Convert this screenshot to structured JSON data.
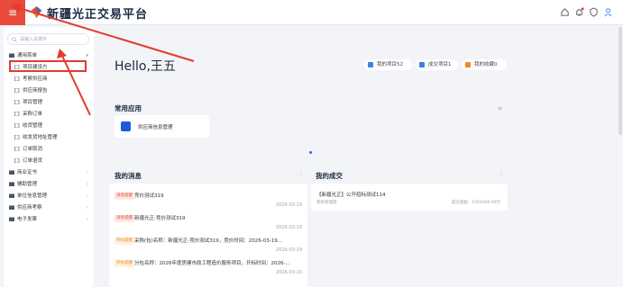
{
  "header": {
    "brand": "新疆光正交易平台",
    "menu_icon": "menu-icon",
    "icons": [
      "home-icon",
      "bell-icon",
      "shield-icon",
      "user-icon"
    ],
    "accent": "#e84b3c"
  },
  "sidebar": {
    "search_placeholder": "请输入关键字",
    "items": [
      {
        "label": "通用菜单",
        "level": 0,
        "expanded": true
      },
      {
        "label": "项目建设方",
        "level": 1,
        "highlighted": true
      },
      {
        "label": "考察供应商",
        "level": 1
      },
      {
        "label": "供应商报告",
        "level": 1
      },
      {
        "label": "项目管理",
        "level": 1
      },
      {
        "label": "采购订单",
        "level": 1
      },
      {
        "label": "收货管理",
        "level": 1
      },
      {
        "label": "收发货地址管理",
        "level": 1
      },
      {
        "label": "订单取消",
        "level": 1
      },
      {
        "label": "订单退货",
        "level": 1
      },
      {
        "label": "商业证书",
        "level": 0
      },
      {
        "label": "辅助管理",
        "level": 0
      },
      {
        "label": "单位信息管理",
        "level": 0
      },
      {
        "label": "供应商考察",
        "level": 0
      },
      {
        "label": "电子发票",
        "level": 0
      }
    ]
  },
  "main": {
    "greeting": "Hello,王五",
    "stats": [
      {
        "label": "我的项目52",
        "color": "#3f7ee8"
      },
      {
        "label": "成交项目1",
        "color": "#3f7ee8"
      },
      {
        "label": "我的收藏0",
        "color": "#f08a1f"
      }
    ],
    "common_title": "常用应用",
    "common_apps": [
      {
        "label": "供应商信息管理",
        "icon": "app-icon"
      }
    ],
    "messages_title": "我的消息",
    "messages": [
      {
        "tag": "消息提醒",
        "tag_color": "red",
        "text": "竞价测试319",
        "date": "2026-03-19"
      },
      {
        "tag": "消息提醒",
        "tag_color": "red",
        "text": "新疆光正-竞价测试319",
        "date": "2026-03-19"
      },
      {
        "tag": "开标提醒",
        "tag_color": "orange",
        "text": "采购(包)名称：新疆光正-竞价测试319，竞价时间：2026-03-19...",
        "date": "2026-03-19"
      },
      {
        "tag": "开标提醒",
        "tag_color": "orange",
        "text": "分包名称：2026年度房建市政工程造价服务项目，开标时间：2026-...",
        "date": "2026-03-10"
      }
    ],
    "deals_title": "我的成交",
    "deals": [
      {
        "title": "【新疆光正】公开招标测试114",
        "org": "系统管理部",
        "amount": "成交金额：1562000.00元"
      }
    ]
  }
}
